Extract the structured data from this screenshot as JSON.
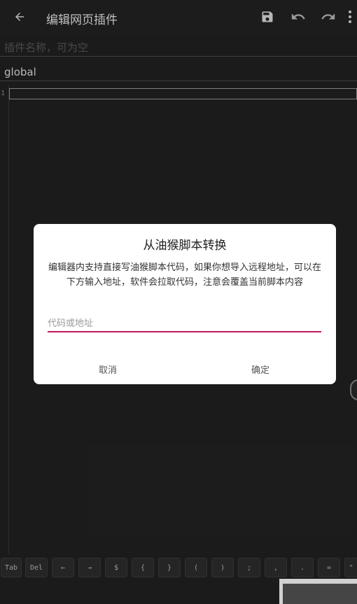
{
  "toolbar": {
    "title": "编辑网页插件",
    "back_icon": "arrow-left-icon",
    "save_icon": "save-icon",
    "undo_icon": "undo-icon",
    "redo_icon": "redo-icon",
    "more_icon": "more-vert-icon"
  },
  "form": {
    "name_placeholder": "插件名称，可为空",
    "name_value": "",
    "scope_value": "global"
  },
  "editor": {
    "line_numbers": [
      "1"
    ]
  },
  "keybar": {
    "keys": [
      "Tab",
      "Del",
      "←",
      "→",
      "$",
      "{",
      "}",
      "(",
      ")",
      ";",
      ",",
      ".",
      "=",
      "\""
    ]
  },
  "dialog": {
    "title": "从油猴脚本转换",
    "message": "编辑器内支持直接写油猴脚本代码，如果你想导入远程地址，可以在下方输入地址，软件会拉取代码，注意会覆盖当前脚本内容",
    "input_placeholder": "代码或地址",
    "input_value": "",
    "cancel_label": "取消",
    "confirm_label": "确定"
  },
  "colors": {
    "background": "#222222",
    "accent": "#c2185b",
    "dialog_bg": "#ffffff"
  }
}
